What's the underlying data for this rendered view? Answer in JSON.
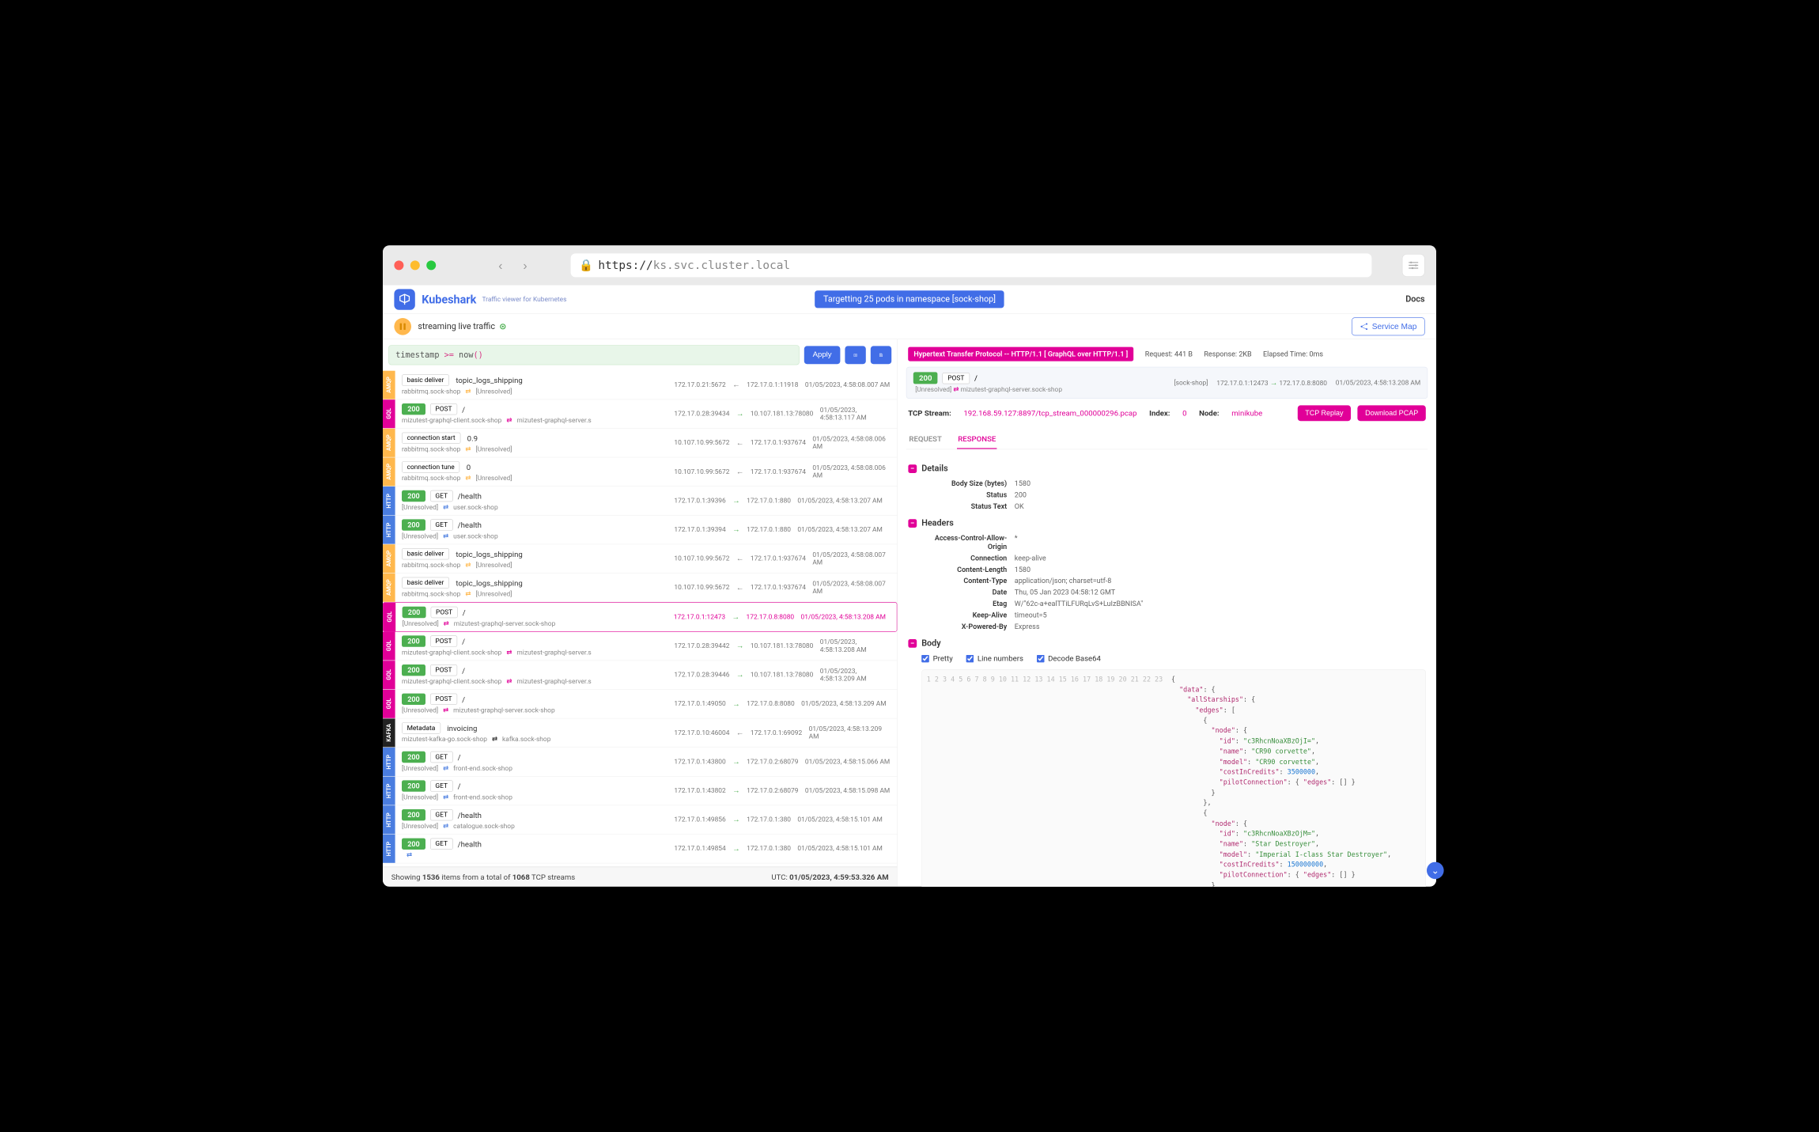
{
  "url": {
    "scheme": "https://",
    "host": "ks.svc.cluster.local"
  },
  "brand": {
    "name": "Kubeshark",
    "tagline": "Traffic viewer for Kubernetes"
  },
  "header": {
    "targeting": "Targetting 25 pods in namespace [sock-shop]",
    "docs": "Docs",
    "live": "streaming live traffic",
    "servicemap": "Service Map"
  },
  "query": {
    "text": "timestamp >= now()",
    "apply": "Apply"
  },
  "status": {
    "left_prefix": "Showing",
    "count": "1536",
    "mid": "items from a total of",
    "total": "1068",
    "suffix": "TCP streams",
    "utc_label": "UTC:",
    "utc": "01/05/2023, 4:59:53.326 AM"
  },
  "rows": [
    {
      "proto": "amqp",
      "line1": {
        "box": "basic deliver",
        "text": "topic_logs_shipping"
      },
      "src": "rabbitmq.sock-shop",
      "swap": "amqp",
      "dst": "[Unresolved]",
      "ip1": "172.17.0.21:5672",
      "dir": "b",
      "ip2": "172.17.0.1:11918",
      "ts": "01/05/2023, 4:58:08.007 AM"
    },
    {
      "proto": "gql",
      "line1": {
        "code": "200",
        "method": "POST",
        "path": "/"
      },
      "src": "mizutest-graphql-client.sock-shop",
      "swap": "gql",
      "dst": "mizutest-graphql-server.s",
      "ip1": "172.17.0.28:39434",
      "dir": "g",
      "ip2": "10.107.181.13:78080",
      "ts": "01/05/2023, 4:58:13.117 AM"
    },
    {
      "proto": "amqp",
      "line1": {
        "box": "connection start",
        "text": "0.9"
      },
      "src": "rabbitmq.sock-shop",
      "swap": "amqp",
      "dst": "[Unresolved]",
      "ip1": "10.107.10.99:5672",
      "dir": "b",
      "ip2": "172.17.0.1:937674",
      "ts": "01/05/2023, 4:58:08.006 AM"
    },
    {
      "proto": "amqp",
      "line1": {
        "box": "connection tune",
        "text": "0"
      },
      "src": "rabbitmq.sock-shop",
      "swap": "amqp",
      "dst": "[Unresolved]",
      "ip1": "10.107.10.99:5672",
      "dir": "b",
      "ip2": "172.17.0.1:937674",
      "ts": "01/05/2023, 4:58:08.006 AM"
    },
    {
      "proto": "http",
      "line1": {
        "code": "200",
        "method": "GET",
        "path": "/health"
      },
      "src": "[Unresolved]",
      "swap": "http",
      "dst": "user.sock-shop",
      "ip1": "172.17.0.1:39396",
      "dir": "g",
      "ip2": "172.17.0.1:880",
      "ts": "01/05/2023, 4:58:13.207 AM"
    },
    {
      "proto": "http",
      "line1": {
        "code": "200",
        "method": "GET",
        "path": "/health"
      },
      "src": "[Unresolved]",
      "swap": "http",
      "dst": "user.sock-shop",
      "ip1": "172.17.0.1:39394",
      "dir": "g",
      "ip2": "172.17.0.1:880",
      "ts": "01/05/2023, 4:58:13.207 AM"
    },
    {
      "proto": "amqp",
      "line1": {
        "box": "basic deliver",
        "text": "topic_logs_shipping"
      },
      "src": "rabbitmq.sock-shop",
      "swap": "amqp",
      "dst": "[Unresolved]",
      "ip1": "10.107.10.99:5672",
      "dir": "b",
      "ip2": "172.17.0.1:937674",
      "ts": "01/05/2023, 4:58:08.007 AM"
    },
    {
      "proto": "amqp",
      "line1": {
        "box": "basic deliver",
        "text": "topic_logs_shipping"
      },
      "src": "rabbitmq.sock-shop",
      "swap": "amqp",
      "dst": "[Unresolved]",
      "ip1": "10.107.10.99:5672",
      "dir": "b",
      "ip2": "172.17.0.1:937674",
      "ts": "01/05/2023, 4:58:08.007 AM"
    },
    {
      "proto": "gql",
      "selected": true,
      "line1": {
        "code": "200",
        "method": "POST",
        "path": "/"
      },
      "src": "[Unresolved]",
      "swap": "gql",
      "dst": "mizutest-graphql-server.sock-shop",
      "ip1": "172.17.0.1:12473",
      "dir": "g",
      "ip2": "172.17.0.8:8080",
      "ts": "01/05/2023, 4:58:13.208 AM"
    },
    {
      "proto": "gql",
      "line1": {
        "code": "200",
        "method": "POST",
        "path": "/"
      },
      "src": "mizutest-graphql-client.sock-shop",
      "swap": "gql",
      "dst": "mizutest-graphql-server.s",
      "ip1": "172.17.0.28:39442",
      "dir": "g",
      "ip2": "10.107.181.13:78080",
      "ts": "01/05/2023, 4:58:13.208 AM"
    },
    {
      "proto": "gql",
      "line1": {
        "code": "200",
        "method": "POST",
        "path": "/"
      },
      "src": "mizutest-graphql-client.sock-shop",
      "swap": "gql",
      "dst": "mizutest-graphql-server.s",
      "ip1": "172.17.0.28:39446",
      "dir": "g",
      "ip2": "10.107.181.13:78080",
      "ts": "01/05/2023, 4:58:13.209 AM"
    },
    {
      "proto": "gql",
      "line1": {
        "code": "200",
        "method": "POST",
        "path": "/"
      },
      "src": "[Unresolved]",
      "swap": "gql",
      "dst": "mizutest-graphql-server.sock-shop",
      "ip1": "172.17.0.1:49050",
      "dir": "g",
      "ip2": "172.17.0.8:8080",
      "ts": "01/05/2023, 4:58:13.209 AM"
    },
    {
      "proto": "kafka",
      "line1": {
        "box": "Metadata",
        "text": "invoicing"
      },
      "src": "mizutest-kafka-go.sock-shop",
      "swap": "kafka",
      "dst": "kafka.sock-shop",
      "ip1": "172.17.0.10:46004",
      "dir": "b",
      "ip2": "172.17.0.1:69092",
      "ts": "01/05/2023, 4:58:13.209 AM"
    },
    {
      "proto": "http",
      "line1": {
        "code": "200",
        "method": "GET",
        "path": "/"
      },
      "src": "[Unresolved]",
      "swap": "http",
      "dst": "front-end.sock-shop",
      "ip1": "172.17.0.1:43800",
      "dir": "g",
      "ip2": "172.17.0.2:68079",
      "ts": "01/05/2023, 4:58:15.066 AM"
    },
    {
      "proto": "http",
      "line1": {
        "code": "200",
        "method": "GET",
        "path": "/"
      },
      "src": "[Unresolved]",
      "swap": "http",
      "dst": "front-end.sock-shop",
      "ip1": "172.17.0.1:43802",
      "dir": "g",
      "ip2": "172.17.0.2:68079",
      "ts": "01/05/2023, 4:58:15.098 AM"
    },
    {
      "proto": "http",
      "line1": {
        "code": "200",
        "method": "GET",
        "path": "/health"
      },
      "src": "[Unresolved]",
      "swap": "http",
      "dst": "catalogue.sock-shop",
      "ip1": "172.17.0.1:49856",
      "dir": "g",
      "ip2": "172.17.0.1:380",
      "ts": "01/05/2023, 4:58:15.101 AM"
    },
    {
      "proto": "http",
      "line1": {
        "code": "200",
        "method": "GET",
        "path": "/health"
      },
      "src": "",
      "swap": "http",
      "dst": "",
      "ip1": "172.17.0.1:49854",
      "dir": "g",
      "ip2": "172.17.0.1:380",
      "ts": "01/05/2023, 4:58:15.101 AM"
    }
  ],
  "detail": {
    "proto": "Hypertext Transfer Protocol -- HTTP/1.1 [ GraphQL over HTTP/1.1 ]",
    "request": "Request: 441 B",
    "response": "Response: 2KB",
    "elapsed": "Elapsed Time: 0ms",
    "top": {
      "code": "200",
      "method": "POST",
      "path": "/",
      "src": "[Unresolved]",
      "dst": "mizutest-graphql-server.sock-shop",
      "ns": "[sock-shop]",
      "ip1": "172.17.0.1:12473",
      "ip2": "172.17.0.8:8080",
      "ts": "01/05/2023, 4:58:13.208 AM"
    },
    "tcp": {
      "label": "TCP Stream:",
      "file": "192.168.59.127:8897/tcp_stream_000000296.pcap",
      "index_label": "Index:",
      "index": "0",
      "node_label": "Node:",
      "node": "minikube",
      "replay": "TCP Replay",
      "download": "Download PCAP"
    },
    "tabs": {
      "request": "REQUEST",
      "response": "RESPONSE"
    },
    "sections": {
      "details": {
        "title": "Details",
        "items": [
          [
            "Body Size (bytes)",
            "1580"
          ],
          [
            "Status",
            "200"
          ],
          [
            "Status Text",
            "OK"
          ]
        ]
      },
      "headers": {
        "title": "Headers",
        "items": [
          [
            "Access-Control-Allow-Origin",
            "*"
          ],
          [
            "Connection",
            "keep-alive"
          ],
          [
            "Content-Length",
            "1580"
          ],
          [
            "Content-Type",
            "application/json; charset=utf-8"
          ],
          [
            "Date",
            "Thu, 05 Jan 2023 04:58:12 GMT"
          ],
          [
            "Etag",
            "W/\"62c-a+ealTTiLFURqLvS+LuIzBBNISA\""
          ],
          [
            "Keep-Alive",
            "timeout=5"
          ],
          [
            "X-Powered-By",
            "Express"
          ]
        ]
      },
      "body": {
        "title": "Body",
        "pretty": "Pretty",
        "linenums": "Line numbers",
        "decode": "Decode Base64"
      }
    },
    "body_lines": [
      "{",
      "  \"data\": {",
      "    \"allStarships\": {",
      "      \"edges\": [",
      "        {",
      "          \"node\": {",
      "            \"id\": \"c3RhcnNoaXBzOjI=\",",
      "            \"name\": \"CR90 corvette\",",
      "            \"model\": \"CR90 corvette\",",
      "            \"costInCredits\": 3500000,",
      "            \"pilotConnection\": { \"edges\": [] }",
      "          }",
      "        },",
      "        {",
      "          \"node\": {",
      "            \"id\": \"c3RhcnNoaXBzOjM=\",",
      "            \"name\": \"Star Destroyer\",",
      "            \"model\": \"Imperial I-class Star Destroyer\",",
      "            \"costInCredits\": 150000000,",
      "            \"pilotConnection\": { \"edges\": [] }",
      "          }",
      "        },",
      "        {"
    ]
  }
}
